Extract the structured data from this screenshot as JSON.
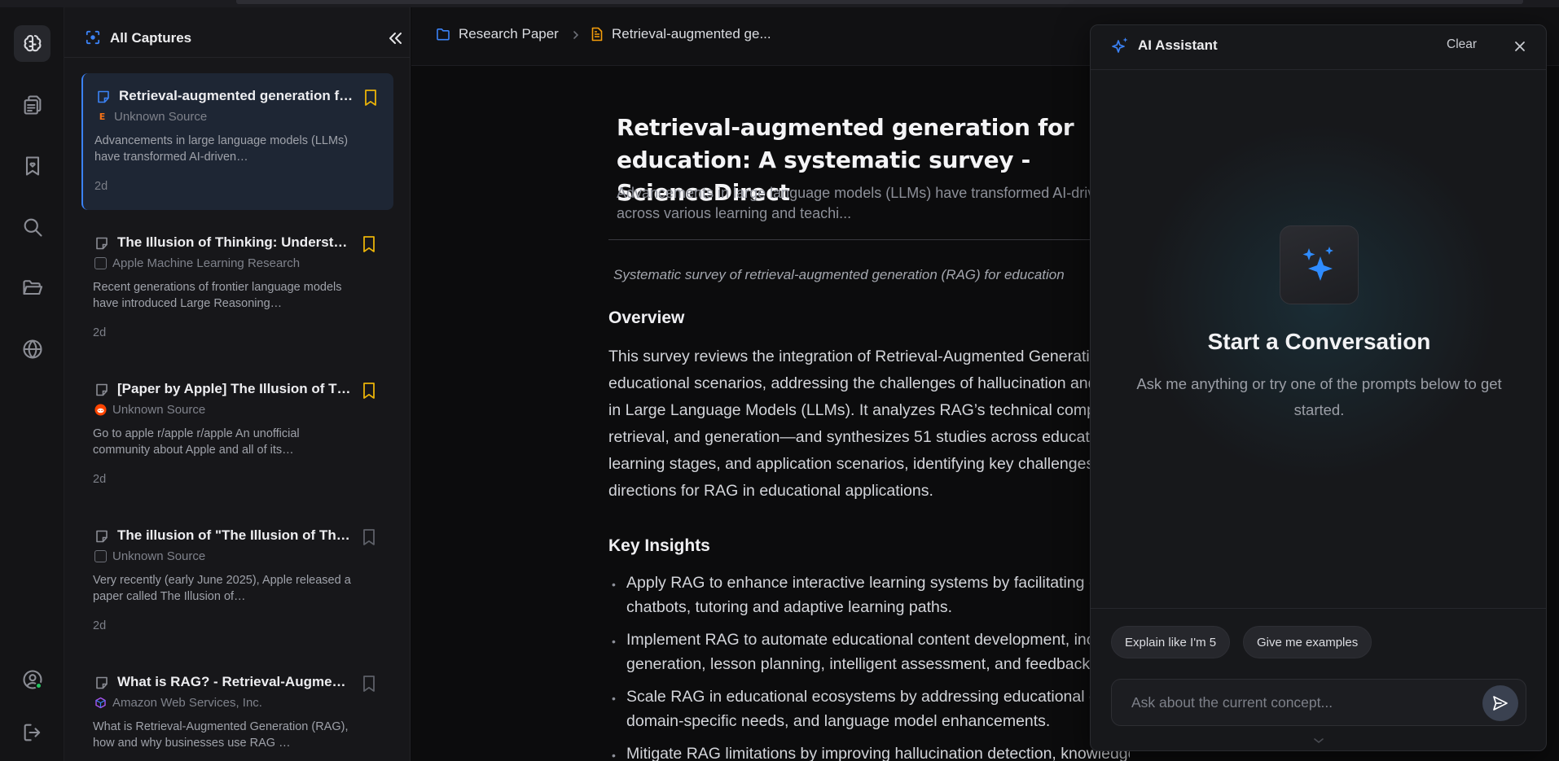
{
  "sidebar": {
    "title": "All Captures",
    "cards": [
      {
        "title": "Retrieval-augmented generation for education: A systematic survey - ScienceDirect",
        "source": "Unknown Source",
        "source_icon_letter": "E",
        "source_icon_color": "#f97316",
        "excerpt": "Advancements in large language models (LLMs) have transformed AI-driven…",
        "age": "2d",
        "bookmarked": true
      },
      {
        "title": "The Illusion of Thinking: Understanding the Strengths and Limitations",
        "source": "Apple Machine Learning Research",
        "excerpt": "Recent generations of frontier language models have introduced Large Reasoning…",
        "age": "2d",
        "bookmarked": true
      },
      {
        "title": "[Paper by Apple] The Illusion of Thinking",
        "source": "Unknown Source",
        "source_icon_color": "#ff4500",
        "excerpt": "Go to apple r/apple r/apple An unofficial community about Apple and all of its…",
        "age": "2d",
        "bookmarked": true
      },
      {
        "title": "The illusion of \"The Illusion of Thinking\"",
        "source": "Unknown Source",
        "excerpt": "Very recently (early June 2025), Apple released a paper called The Illusion of…",
        "age": "2d",
        "bookmarked": false
      },
      {
        "title": "What is RAG? - Retrieval-Augmented Generation AI Explained - AWS",
        "source": "Amazon Web Services, Inc.",
        "source_icon_color": "#a855f7",
        "excerpt": "What is Retrieval-Augmented Generation (RAG), how and why businesses use RAG …",
        "age": "",
        "bookmarked": false
      }
    ]
  },
  "breadcrumb": {
    "folder": "Research Paper",
    "document": "Retrieval-augmented ge..."
  },
  "document": {
    "title": "Retrieval-augmented generation for education: A systematic survey - ScienceDirect",
    "subtitle": "Advancements in large language models (LLMs) have transformed AI-driven applications across various learning and teachi...",
    "tagline": "Systematic survey of retrieval-augmented generation (RAG) for education",
    "overview_heading": "Overview",
    "overview_text": "This survey reviews the integration of Retrieval-Augmented Generation (RAG) into educational scenarios, addressing the challenges of hallucination and static knowledge in Large Language Models (LLMs). It analyzes RAG’s technical components—indexing, retrieval, and generation—and synthesizes 51 studies across educational goals, learning stages, and application scenarios, identifying key challenges and future directions for RAG in educational applications.",
    "insights_heading": "Key Insights",
    "insights": [
      "Apply RAG to enhance interactive learning systems by facilitating conversational chatbots, tutoring and adaptive learning paths.",
      "Implement RAG to automate educational content development, including question generation, lesson planning, intelligent assessment, and feedback.",
      "Scale RAG in educational ecosystems by addressing educational data privacy, domain-specific needs, and language model enhancements.",
      "Mitigate RAG limitations by improving hallucination detection, knowledge base updates, and"
    ]
  },
  "assistant": {
    "title": "AI Assistant",
    "clear_label": "Clear",
    "heading": "Start a Conversation",
    "subheading": "Ask me anything or try one of the prompts below to get started.",
    "prompts": [
      "Explain like I'm 5",
      "Give me examples"
    ],
    "input_placeholder": "Ask about the current concept...",
    "accent_color": "#3b82f6"
  },
  "colors": {
    "accent": "#3b82f6",
    "bookmark": "#eab308",
    "online": "#22c55e"
  }
}
